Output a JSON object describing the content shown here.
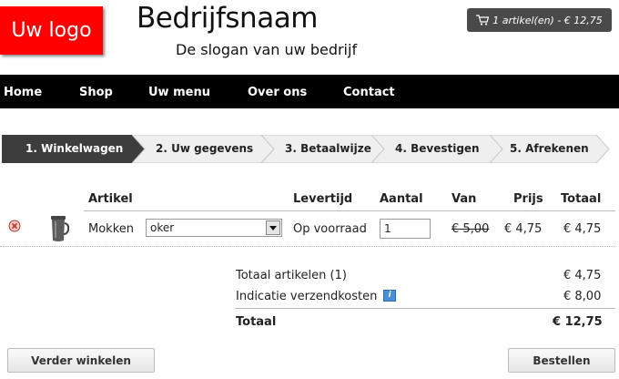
{
  "header": {
    "logo_text": "Uw logo",
    "company_name": "Bedrijfsnaam",
    "slogan": "De slogan van uw bedrijf",
    "cart_summary": "1 artikel(en) - € 12,75",
    "cart_icon": "shopping-cart-icon"
  },
  "nav": {
    "items": [
      {
        "label": "Home"
      },
      {
        "label": "Shop"
      },
      {
        "label": "Uw menu"
      },
      {
        "label": "Over ons"
      },
      {
        "label": "Contact"
      }
    ]
  },
  "steps": [
    {
      "label": "1. Winkelwagen",
      "active": true
    },
    {
      "label": "2. Uw gegevens",
      "active": false
    },
    {
      "label": "3. Betaalwijze",
      "active": false
    },
    {
      "label": "4. Bevestigen",
      "active": false
    },
    {
      "label": "5. Afrekenen",
      "active": false
    }
  ],
  "table": {
    "headers": {
      "artikel": "Artikel",
      "levertijd": "Levertijd",
      "aantal": "Aantal",
      "van": "Van",
      "prijs": "Prijs",
      "totaal": "Totaal"
    },
    "rows": [
      {
        "remove_icon": "remove-icon",
        "image_icon": "mug-icon",
        "name": "Mokken",
        "option": "oker",
        "levertijd": "Op voorraad",
        "aantal": "1",
        "van": "€ 5,00",
        "prijs": "€ 4,75",
        "totaal": "€ 4,75"
      }
    ]
  },
  "totals": {
    "artikelen_label": "Totaal artikelen (1)",
    "artikelen_value": "€ 4,75",
    "verzend_label": "Indicatie verzendkosten",
    "verzend_icon": "info-icon",
    "verzend_value": "€ 8,00",
    "totaal_label": "Totaal",
    "totaal_value": "€ 12,75"
  },
  "buttons": {
    "continue_label": "Verder winkelen",
    "order_label": "Bestellen"
  },
  "colors": {
    "logo_bg": "#ff0000",
    "nav_bg": "#000000",
    "active_step_bg": "#3d3d3d",
    "cart_bg": "#4a4a4a"
  }
}
